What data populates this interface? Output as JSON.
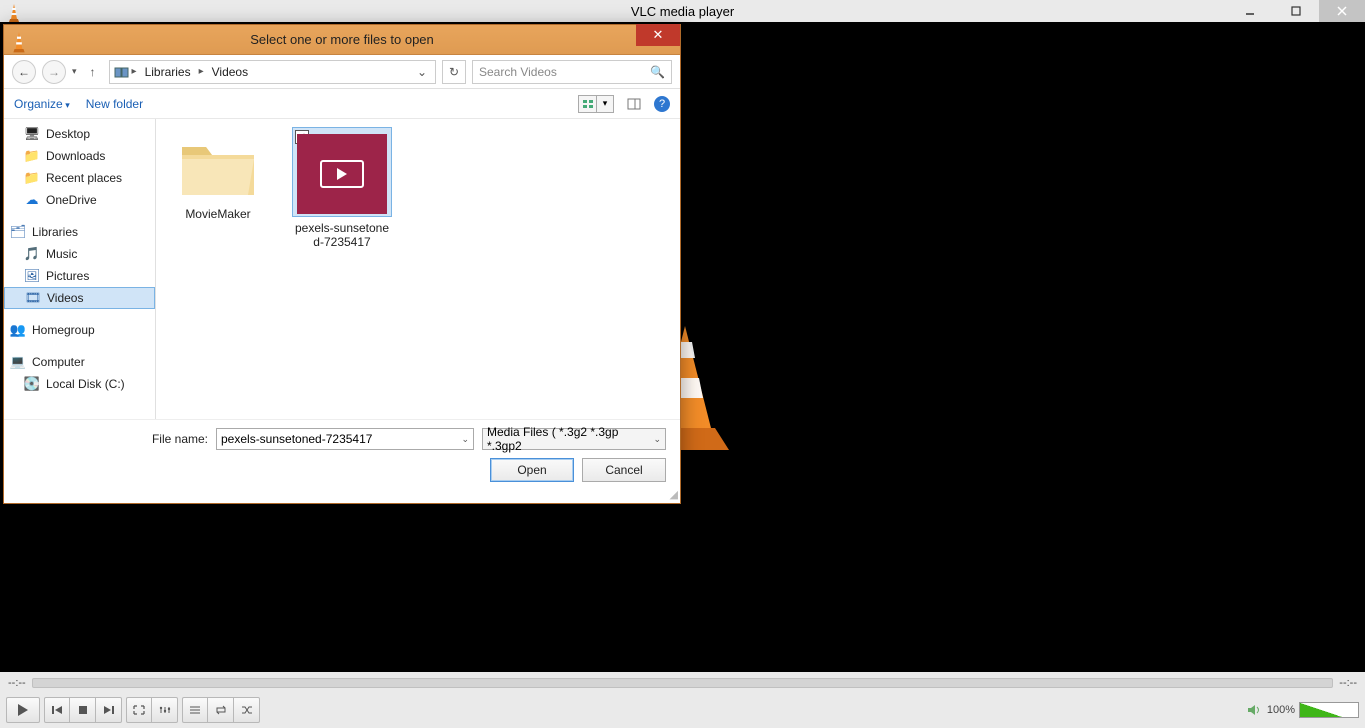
{
  "vlc": {
    "title": "VLC media player",
    "time_left": "--:--",
    "time_right": "--:--",
    "volume_pct": "100%"
  },
  "dialog": {
    "title": "Select one or more files to open",
    "breadcrumb": {
      "seg1": "Libraries",
      "seg2": "Videos"
    },
    "search_placeholder": "Search Videos",
    "toolbar": {
      "organize": "Organize",
      "new_folder": "New folder"
    },
    "tree": {
      "desktop": "Desktop",
      "downloads": "Downloads",
      "recent": "Recent places",
      "onedrive": "OneDrive",
      "libraries": "Libraries",
      "music": "Music",
      "pictures": "Pictures",
      "videos": "Videos",
      "homegroup": "Homegroup",
      "computer": "Computer",
      "local_c": "Local Disk (C:)"
    },
    "files": {
      "item1": "MovieMaker",
      "item2_l1": "pexels-sunsetone",
      "item2_l2": "d-7235417"
    },
    "filename_label": "File name:",
    "filename_value": "pexels-sunsetoned-7235417",
    "filetype_value": "Media Files ( *.3g2 *.3gp *.3gp2",
    "open": "Open",
    "cancel": "Cancel"
  }
}
